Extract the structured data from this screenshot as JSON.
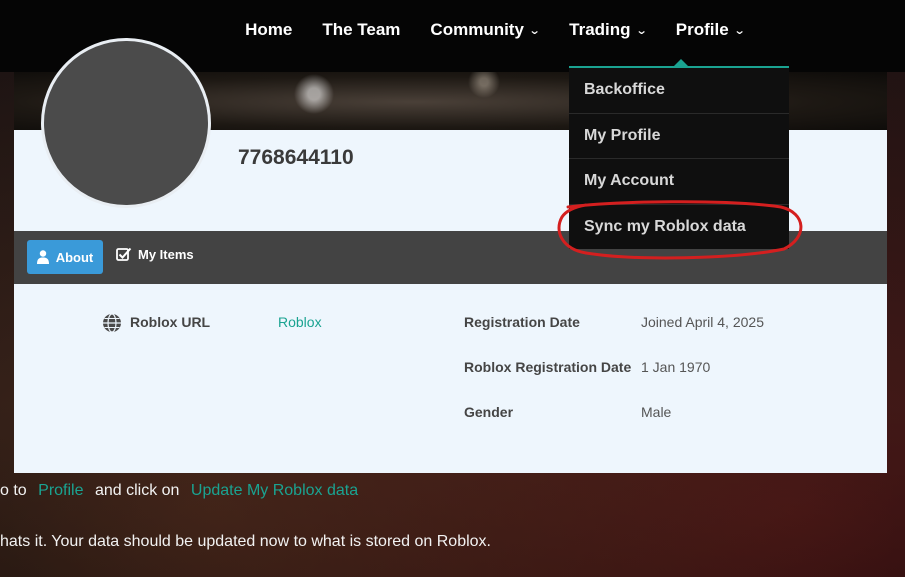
{
  "nav": {
    "items": [
      {
        "label": "Home",
        "has_dropdown": false
      },
      {
        "label": "The Team",
        "has_dropdown": false
      },
      {
        "label": "Community",
        "has_dropdown": true
      },
      {
        "label": "Trading",
        "has_dropdown": true
      },
      {
        "label": "Profile",
        "has_dropdown": true
      }
    ]
  },
  "profile_menu": {
    "items": [
      "Backoffice",
      "My Profile",
      "My Account",
      "Sync my Roblox data"
    ],
    "highlighted": "Sync my Roblox data",
    "annotation_color": "#d41f1f"
  },
  "profile": {
    "username": "7768644110",
    "tabs": {
      "about": "About",
      "my_items": "My Items"
    },
    "fields": {
      "roblox_url_label": "Roblox URL",
      "roblox_url_value": "Roblox",
      "registration_date_label": "Registration Date",
      "registration_date_value": "Joined April 4, 2025",
      "roblox_registration_label": "Roblox Registration Date",
      "roblox_registration_value": "1 Jan 1970",
      "gender_label": "Gender",
      "gender_value": "Male"
    }
  },
  "instructions": {
    "line1_prefix": "o to",
    "line1_link1": "Profile",
    "line1_middle": "and click on",
    "line1_link2": "Update My Roblox data",
    "line2": "hats it. Your data should be updated now to what is stored on Roblox."
  },
  "colors": {
    "accent": "#1aa391",
    "about_tab": "#3a9ad9",
    "nav_bg": "#050505",
    "card_bg": "#eef6fd"
  }
}
